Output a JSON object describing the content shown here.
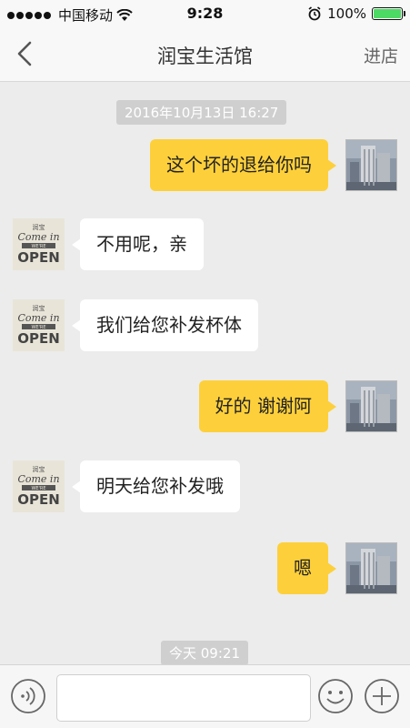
{
  "status_bar": {
    "carrier": "中国移动",
    "time": "9:28",
    "battery": "100%",
    "battery_level": 1.0,
    "signal_bars": 5
  },
  "nav": {
    "title": "润宝生活馆",
    "action": "进店"
  },
  "messages": {
    "timestamp_1": "2016年10月13日 16:27",
    "msg_1": "这个坏的退给你吗",
    "msg_2": "不用呢，亲",
    "msg_3": "我们给您补发杯体",
    "msg_4": "好的 谢谢阿",
    "msg_5": "明天给您补发哦",
    "msg_6": "嗯",
    "timestamp_2": "今天 09:21"
  },
  "merchant_avatar": {
    "line1": "润宝",
    "line2": "Come in",
    "line3": "WE'RE",
    "line4": "OPEN"
  },
  "input": {
    "value": "",
    "placeholder": ""
  },
  "colors": {
    "accent_bubble": "#fdd03b",
    "incoming_bubble": "#ffffff",
    "background": "#ececec"
  }
}
